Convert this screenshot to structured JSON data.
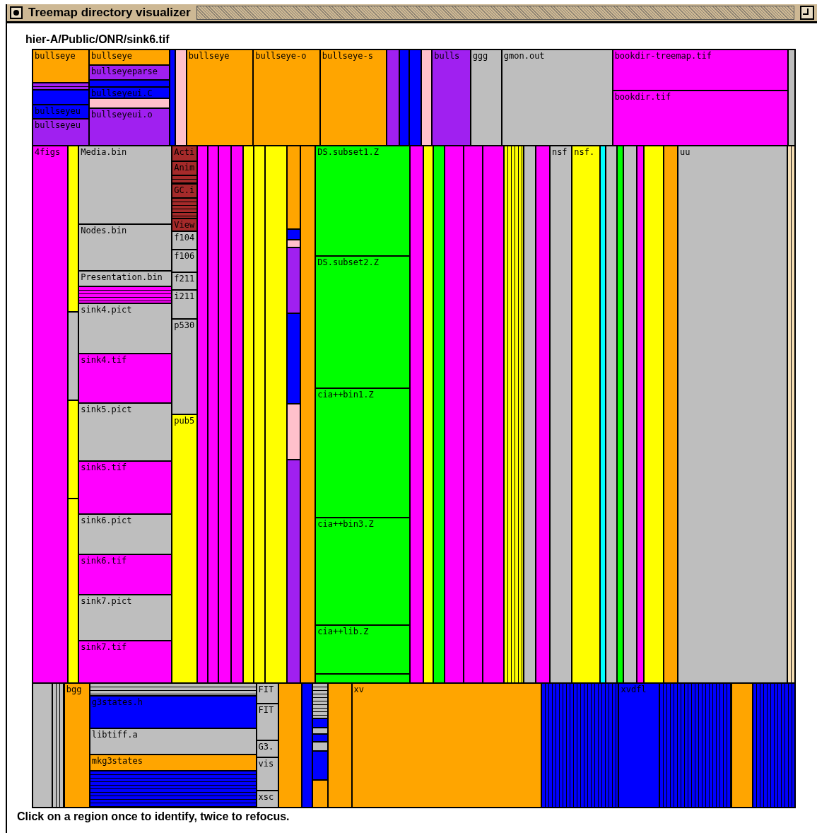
{
  "window": {
    "title": "Treemap directory visualizer"
  },
  "path": "hier-A/Public/ONR/sink6.tif",
  "treemap": {
    "bands": [
      {
        "cells": [
          {
            "kind": "dir",
            "children": [
              {
                "kind": "file",
                "color": "#ffa500",
                "label": "bullseye"
              },
              {
                "kind": "stripes",
                "color": "#a020f0"
              },
              {
                "kind": "file",
                "color": "#0000ff"
              },
              {
                "kind": "file",
                "color": "#0000ff",
                "label": "bullseyeu"
              },
              {
                "kind": "file",
                "color": "#a020f0",
                "label": "bullseyeu"
              }
            ]
          },
          {
            "kind": "dir",
            "children": [
              {
                "kind": "file",
                "color": "#ffa500",
                "label": "bullseye"
              },
              {
                "kind": "file",
                "color": "#a020f0",
                "label": "bullseyeparse"
              },
              {
                "kind": "file",
                "color": "#0000ff"
              },
              {
                "kind": "file",
                "color": "#0000ff",
                "label": "bullseyeui.C"
              },
              {
                "kind": "file",
                "color": "#ffc0cb"
              },
              {
                "kind": "file",
                "color": "#a020f0",
                "label": "bullseyeui.o"
              }
            ]
          },
          {
            "kind": "file",
            "color": "#0000ff"
          },
          {
            "kind": "file",
            "color": "#ffc0cb"
          },
          {
            "kind": "file",
            "color": "#ffa500",
            "label": "bullseye"
          },
          {
            "kind": "file",
            "color": "#ffa500",
            "label": "bullseye-o"
          },
          {
            "kind": "file",
            "color": "#ffa500",
            "label": "bullseye-s"
          },
          {
            "kind": "file",
            "color": "#a020f0"
          },
          {
            "kind": "file",
            "color": "#0000ff"
          },
          {
            "kind": "file",
            "color": "#0000ff"
          },
          {
            "kind": "file",
            "color": "#ffc0cb"
          },
          {
            "kind": "file",
            "color": "#a020f0",
            "label": "bulls"
          },
          {
            "kind": "file",
            "color": "#bebebe",
            "label": "ggg"
          },
          {
            "kind": "file",
            "color": "#bebebe",
            "label": "gmon.out"
          },
          {
            "kind": "dir",
            "children": [
              {
                "kind": "file",
                "color": "#ff00ff",
                "label": "bookdir-treemap.tif"
              },
              {
                "kind": "file",
                "color": "#ff00ff",
                "label": "bookdir.tif"
              }
            ]
          },
          {
            "kind": "file",
            "color": "#bebebe"
          }
        ]
      },
      {
        "cells": [
          {
            "kind": "file",
            "color": "#ff00ff",
            "label": "4figs"
          },
          {
            "kind": "dir",
            "children": [
              {
                "kind": "file",
                "color": "#ffff00"
              },
              {
                "kind": "file",
                "color": "#bebebe"
              },
              {
                "kind": "file",
                "color": "#ffff00"
              },
              {
                "kind": "file",
                "color": "#ffff00"
              }
            ]
          },
          {
            "kind": "dir",
            "children": [
              {
                "kind": "file",
                "color": "#bebebe",
                "label": "Media.bin"
              },
              {
                "kind": "file",
                "color": "#bebebe",
                "label": "Nodes.bin"
              },
              {
                "kind": "file",
                "color": "#bebebe",
                "label": "Presentation.bin"
              },
              {
                "kind": "stripes",
                "color": "#ff00ff"
              },
              {
                "kind": "file",
                "color": "#bebebe",
                "label": "sink4.pict"
              },
              {
                "kind": "file",
                "color": "#ff00ff",
                "label": "sink4.tif"
              },
              {
                "kind": "file",
                "color": "#bebebe",
                "label": "sink5.pict"
              },
              {
                "kind": "file",
                "color": "#ff00ff",
                "label": "sink5.tif"
              },
              {
                "kind": "file",
                "color": "#bebebe",
                "label": "sink6.pict"
              },
              {
                "kind": "file",
                "color": "#ff00ff",
                "label": "sink6.tif"
              },
              {
                "kind": "file",
                "color": "#bebebe",
                "label": "sink7.pict"
              },
              {
                "kind": "file",
                "color": "#ff00ff",
                "label": "sink7.tif"
              }
            ]
          },
          {
            "kind": "dir",
            "children": [
              {
                "kind": "file",
                "color": "#a52a2a",
                "label": "Acti"
              },
              {
                "kind": "file",
                "color": "#a52a2a",
                "label": "Anim"
              },
              {
                "kind": "stripes",
                "color": "#a52a2a"
              },
              {
                "kind": "file",
                "color": "#a52a2a",
                "label": "GC.i"
              },
              {
                "kind": "stripes",
                "color": "#a52a2a"
              },
              {
                "kind": "file",
                "color": "#a52a2a",
                "label": "View"
              },
              {
                "kind": "file",
                "color": "#bebebe",
                "label": "f104"
              },
              {
                "kind": "file",
                "color": "#bebebe",
                "label": "f106"
              },
              {
                "kind": "file",
                "color": "#bebebe",
                "label": "f211"
              },
              {
                "kind": "file",
                "color": "#bebebe",
                "label": "i211"
              },
              {
                "kind": "file",
                "color": "#bebebe",
                "label": "p530"
              },
              {
                "kind": "file",
                "color": "#ffff00",
                "label": "pub5"
              }
            ]
          },
          {
            "kind": "file",
            "color": "#ff00ff"
          },
          {
            "kind": "file",
            "color": "#ff00ff"
          },
          {
            "kind": "file",
            "color": "#ff00ff"
          },
          {
            "kind": "file",
            "color": "#ff00ff"
          },
          {
            "kind": "file",
            "color": "#ffff00"
          },
          {
            "kind": "file",
            "color": "#ffff00"
          },
          {
            "kind": "file",
            "color": "#ffff00"
          },
          {
            "kind": "dir",
            "children": [
              {
                "kind": "file",
                "color": "#ffa500"
              },
              {
                "kind": "file",
                "color": "#0000ff"
              },
              {
                "kind": "file",
                "color": "#ffc0cb"
              },
              {
                "kind": "file",
                "color": "#a020f0"
              },
              {
                "kind": "file",
                "color": "#0000ff"
              },
              {
                "kind": "file",
                "color": "#ffc0cb"
              },
              {
                "kind": "file",
                "color": "#a020f0"
              }
            ]
          },
          {
            "kind": "file",
            "color": "#ffa500"
          },
          {
            "kind": "dir",
            "children": [
              {
                "kind": "file",
                "color": "#00ff00",
                "label": "DS.subset1.Z"
              },
              {
                "kind": "file",
                "color": "#00ff00",
                "label": "DS.subset2.Z"
              },
              {
                "kind": "file",
                "color": "#00ff00",
                "label": "cia++bin1.Z"
              },
              {
                "kind": "file",
                "color": "#00ff00",
                "label": "cia++bin3.Z"
              },
              {
                "kind": "file",
                "color": "#00ff00",
                "label": "cia++lib.Z"
              },
              {
                "kind": "file",
                "color": "#00ff00"
              }
            ]
          },
          {
            "kind": "file",
            "color": "#ff00ff"
          },
          {
            "kind": "file",
            "color": "#ffff00"
          },
          {
            "kind": "file",
            "color": "#00ff00"
          },
          {
            "kind": "file",
            "color": "#ff00ff"
          },
          {
            "kind": "file",
            "color": "#ff00ff"
          },
          {
            "kind": "file",
            "color": "#ff00ff"
          },
          {
            "kind": "stripes",
            "color": "#ffff00"
          },
          {
            "kind": "file",
            "color": "#bebebe"
          },
          {
            "kind": "file",
            "color": "#ff00ff"
          },
          {
            "kind": "file",
            "color": "#bebebe",
            "label": "nsf"
          },
          {
            "kind": "file",
            "color": "#ffff00",
            "label": "nsf."
          },
          {
            "kind": "file",
            "color": "#00ffff"
          },
          {
            "kind": "file",
            "color": "#bebebe"
          },
          {
            "kind": "file",
            "color": "#00ff00"
          },
          {
            "kind": "file",
            "color": "#bebebe"
          },
          {
            "kind": "file",
            "color": "#ff00ff"
          },
          {
            "kind": "file",
            "color": "#ffff00"
          },
          {
            "kind": "file",
            "color": "#ffa500"
          },
          {
            "kind": "file",
            "color": "#bebebe",
            "label": "uu"
          },
          {
            "kind": "stripes",
            "color": "#f5deb3"
          }
        ]
      },
      {
        "cells": [
          {
            "kind": "file",
            "color": "#bebebe"
          },
          {
            "kind": "stripes",
            "color": "#bebebe"
          },
          {
            "kind": "file",
            "color": "#ffa500",
            "label": "bgg"
          },
          {
            "kind": "dir",
            "children": [
              {
                "kind": "stripes",
                "color": "#bebebe"
              },
              {
                "kind": "file",
                "color": "#0000ff",
                "label": "g3states.h"
              },
              {
                "kind": "file",
                "color": "#bebebe",
                "label": "libtiff.a"
              },
              {
                "kind": "file",
                "color": "#ffa500",
                "label": "mkg3states"
              },
              {
                "kind": "stripes",
                "color": "#0000ff"
              }
            ]
          },
          {
            "kind": "dir",
            "children": [
              {
                "kind": "file",
                "color": "#bebebe",
                "label": "FIT"
              },
              {
                "kind": "file",
                "color": "#bebebe",
                "label": "FIT"
              },
              {
                "kind": "file",
                "color": "#bebebe",
                "label": "G3."
              },
              {
                "kind": "file",
                "color": "#bebebe",
                "label": "vis"
              },
              {
                "kind": "file",
                "color": "#bebebe",
                "label": "xsc"
              }
            ]
          },
          {
            "kind": "file",
            "color": "#ffa500"
          },
          {
            "kind": "file",
            "color": "#0000ff"
          },
          {
            "kind": "dir",
            "children": [
              {
                "kind": "stripes",
                "color": "#bebebe"
              },
              {
                "kind": "file",
                "color": "#0000ff"
              },
              {
                "kind": "file",
                "color": "#bebebe"
              },
              {
                "kind": "file",
                "color": "#0000ff"
              },
              {
                "kind": "file",
                "color": "#bebebe"
              },
              {
                "kind": "file",
                "color": "#0000ff"
              },
              {
                "kind": "file",
                "color": "#ffa500"
              }
            ]
          },
          {
            "kind": "file",
            "color": "#ffa500"
          },
          {
            "kind": "file",
            "color": "#ffa500",
            "label": "xv"
          },
          {
            "kind": "stripes",
            "color": "#0000ff"
          },
          {
            "kind": "file",
            "color": "#0000ff",
            "label": "xvdfl"
          },
          {
            "kind": "stripes",
            "color": "#0000ff"
          },
          {
            "kind": "file",
            "color": "#ffa500"
          },
          {
            "kind": "stripes",
            "color": "#0000ff"
          }
        ]
      }
    ]
  },
  "status": "Click on a region once to identify, twice to refocus."
}
